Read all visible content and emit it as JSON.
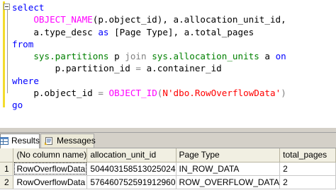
{
  "editor": {
    "lines": [
      {
        "kw1": "select"
      },
      {
        "indent": "    ",
        "fn": "OBJECT_NAME",
        "t1": "(p.object_id), a.allocation_unit_id,"
      },
      {
        "indent": "    ",
        "t1": "a.type_desc ",
        "kw": "as",
        "t2": " [Page Type], a.total_pages"
      },
      {
        "kw1": "from"
      },
      {
        "indent": "    ",
        "sys1": "sys.partitions",
        "t1": " p ",
        "op1": "join",
        "t2": " ",
        "sys2": "sys.allocation_units",
        "t3": " a ",
        "kw": "on"
      },
      {
        "indent": "        ",
        "t1": "p.partition_id ",
        "op1": "=",
        "t2": " a.container_id"
      },
      {
        "kw1": "where"
      },
      {
        "indent": "    ",
        "t1": "p.object_id ",
        "op1": "=",
        "t2": " ",
        "fn": "OBJECT_ID",
        "t3": "(",
        "str": "N'dbo.RowOverflowData'",
        "t4": ")"
      },
      {
        "kw1": "go"
      }
    ]
  },
  "tabs": {
    "results_label": "Results",
    "messages_label": "Messages"
  },
  "grid": {
    "columns": [
      "(No column name)",
      "allocation_unit_id",
      "Page Type",
      "total_pages"
    ],
    "rows": [
      {
        "num": "1",
        "cells": [
          "RowOverflowData",
          "504403158513025024",
          "IN_ROW_DATA",
          "2"
        ]
      },
      {
        "num": "2",
        "cells": [
          "RowOverflowData",
          "576460752591912960",
          "ROW_OVERFLOW_DATA",
          "2"
        ]
      }
    ]
  },
  "colors": {
    "keyword": "#0000ff",
    "function": "#ff00ff",
    "system_object": "#008000",
    "operator": "#808080",
    "string": "#ff0000"
  }
}
